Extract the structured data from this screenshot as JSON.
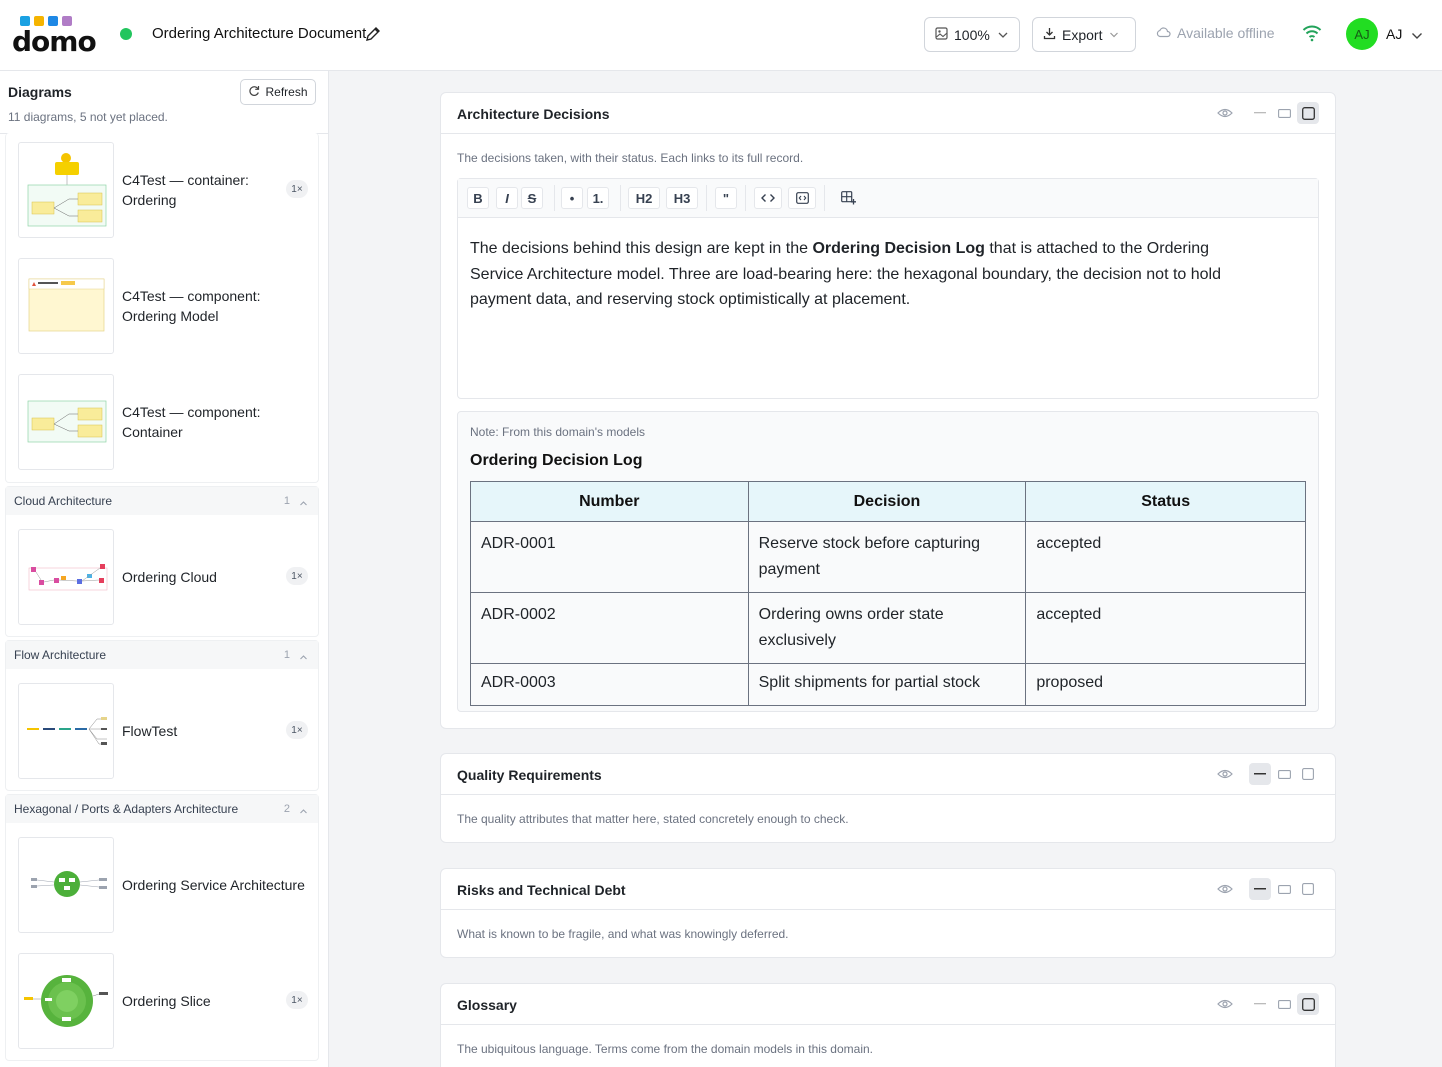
{
  "header": {
    "logo_text": "domo",
    "logo_colors": [
      "#1ba1e2",
      "#f5b400",
      "#1e88e5",
      "#b07cc6"
    ],
    "doc_title": "Ordering Architecture Document",
    "zoom_label": "100%",
    "export_label": "Export",
    "offline_label": "Available offline",
    "user_initials": "AJ",
    "avatar_initials": "AJ",
    "status_color": "#22c55e",
    "avatar_color": "#22dd22"
  },
  "sidebar": {
    "title": "Diagrams",
    "subtitle": "11 diagrams, 5 not yet placed.",
    "refresh_label": "Refresh",
    "top_items": [
      {
        "label": "C4Test — container: Ordering",
        "badge": "1×"
      },
      {
        "label": "C4Test — component: Ordering Model",
        "badge": ""
      },
      {
        "label": "C4Test — component: Container",
        "badge": ""
      }
    ],
    "groups": [
      {
        "name": "Cloud Architecture",
        "count": "1",
        "items": [
          {
            "label": "Ordering Cloud",
            "badge": "1×"
          }
        ]
      },
      {
        "name": "Flow Architecture",
        "count": "1",
        "items": [
          {
            "label": "FlowTest",
            "badge": "1×"
          }
        ]
      },
      {
        "name": "Hexagonal / Ports & Adapters Architecture",
        "count": "2",
        "items": [
          {
            "label": "Ordering Service Architecture",
            "badge": ""
          },
          {
            "label": "Ordering Slice",
            "badge": "1×"
          }
        ]
      }
    ]
  },
  "main": {
    "decisions": {
      "title": "Architecture Decisions",
      "description": "The decisions taken, with their status. Each links to its full record.",
      "toolbar": [
        "B",
        "I",
        "S",
        "•",
        "1.",
        "H2",
        "H3",
        "\"",
        "code-icon",
        "code-block-icon",
        "table-icon"
      ],
      "body_prefix": "The decisions behind this design are kept in the ",
      "body_bold": "Ordering Decision Log",
      "body_suffix": " that is attached to the Ordering Service Architecture model. Three are load-bearing here: the hexagonal boundary, the decision not to hold payment data, and reserving stock optimistically at placement.",
      "note_label": "Note: From this domain's models",
      "log_title": "Ordering Decision Log",
      "table": {
        "headers": [
          "Number",
          "Decision",
          "Status"
        ],
        "rows": [
          [
            "ADR-0001",
            "Reserve stock before capturing payment",
            "accepted"
          ],
          [
            "ADR-0002",
            "Ordering owns order state exclusively",
            "accepted"
          ],
          [
            "ADR-0003",
            "Split shipments for partial stock",
            "proposed"
          ]
        ]
      }
    },
    "quality": {
      "title": "Quality Requirements",
      "description": "The quality attributes that matter here, stated concretely enough to check."
    },
    "risks": {
      "title": "Risks and Technical Debt",
      "description": "What is known to be fragile, and what was knowingly deferred."
    },
    "glossary": {
      "title": "Glossary",
      "description": "The ubiquitous language. Terms come from the domain models in this domain."
    }
  }
}
